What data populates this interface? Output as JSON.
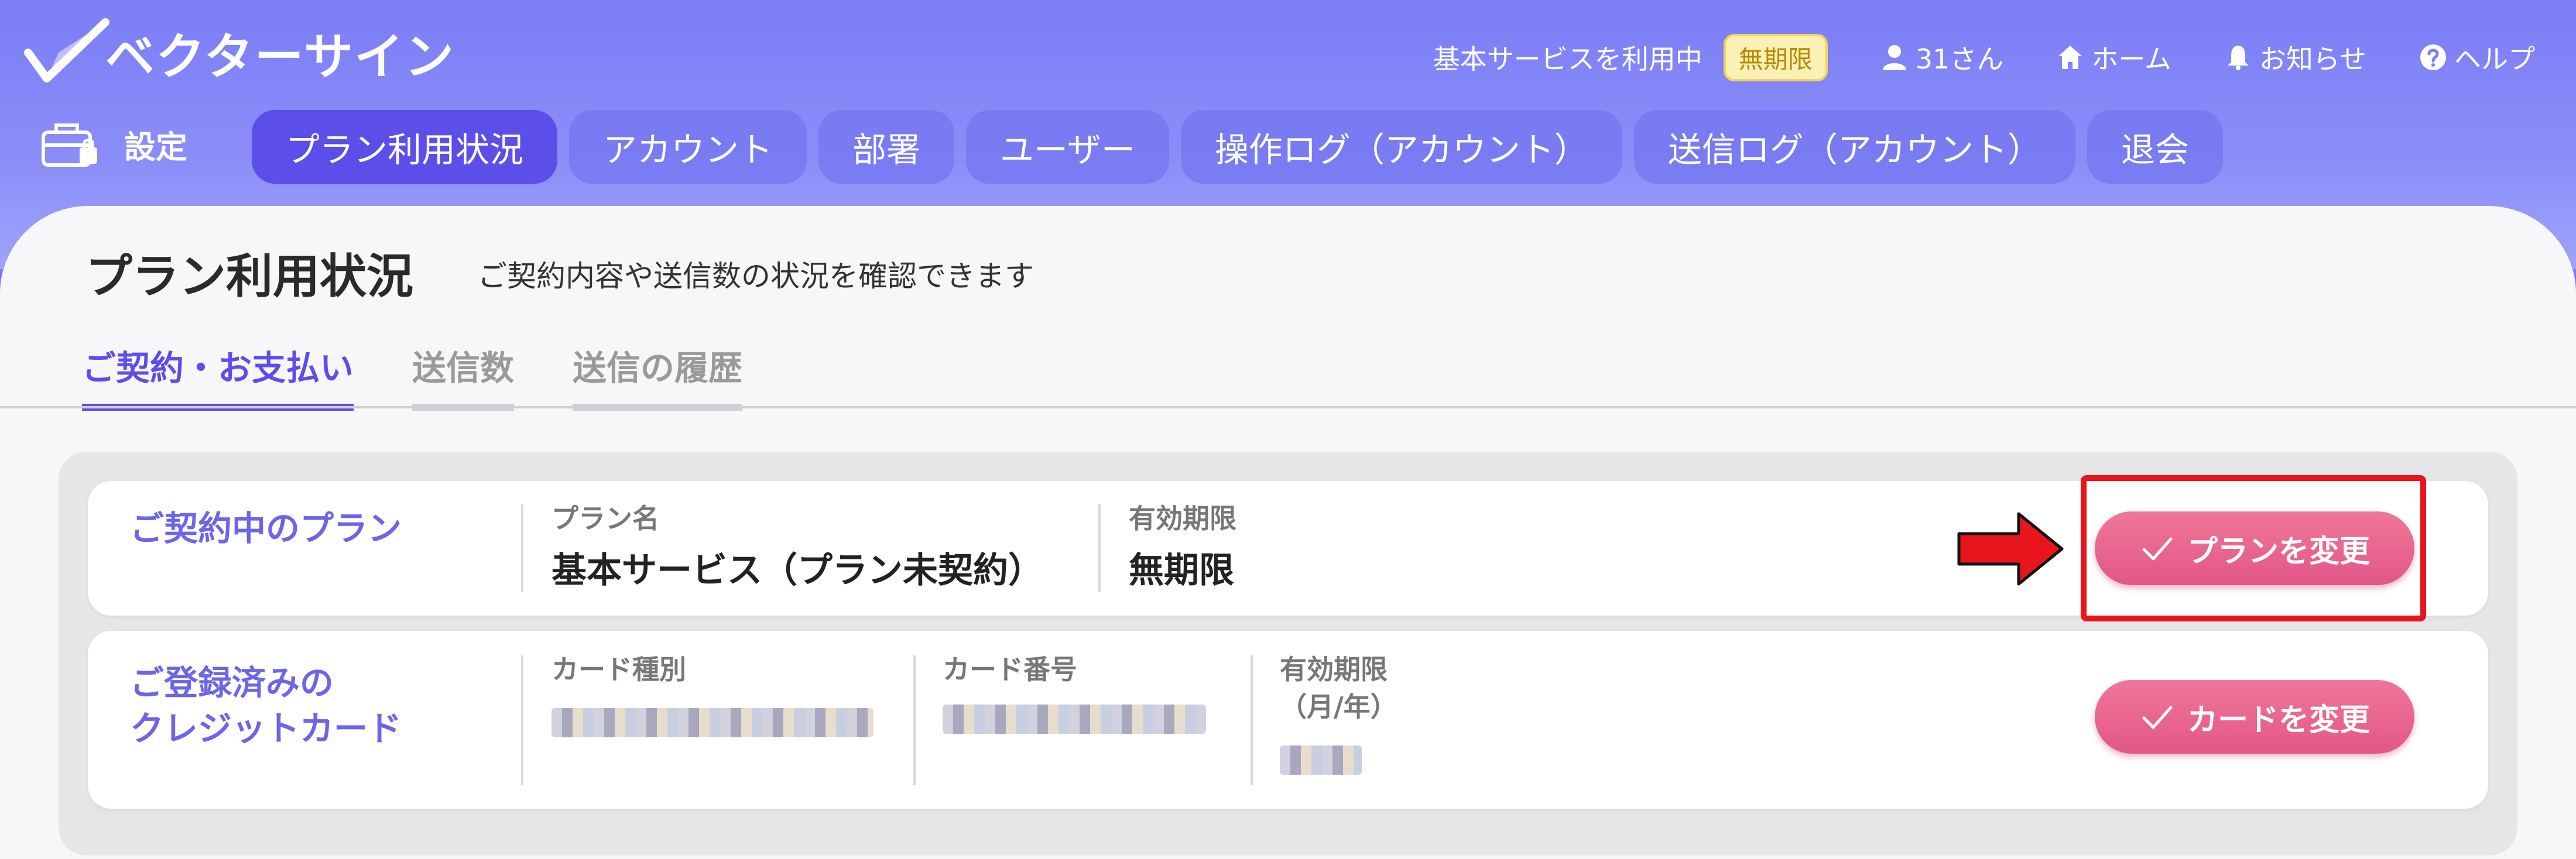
{
  "app": {
    "logo_text": "ベクターサイン"
  },
  "topnav": {
    "service_text": "基本サービスを利用中",
    "service_badge": "無期限",
    "user": "31さん",
    "home": "ホーム",
    "notice": "お知らせ",
    "help": "ヘルプ"
  },
  "settings_label": "設定",
  "tabs": [
    {
      "label": "プラン利用状況",
      "active": true
    },
    {
      "label": "アカウント"
    },
    {
      "label": "部署"
    },
    {
      "label": "ユーザー"
    },
    {
      "label": "操作ログ（アカウント）"
    },
    {
      "label": "送信ログ（アカウント）"
    },
    {
      "label": "退会"
    }
  ],
  "page": {
    "title": "プラン利用状況",
    "subtitle": "ご契約内容や送信数の状況を確認できます"
  },
  "subtabs": [
    {
      "label": "ご契約・お支払い",
      "active": true
    },
    {
      "label": "送信数"
    },
    {
      "label": "送信の履歴"
    }
  ],
  "plan_row": {
    "title": "ご契約中のプラン",
    "plan_name_label": "プラン名",
    "plan_name_value": "基本サービス（プラン未契約）",
    "expiry_label": "有効期限",
    "expiry_value": "無期限",
    "button": "プランを変更"
  },
  "card_row": {
    "title_line1": "ご登録済みの",
    "title_line2": "クレジットカード",
    "card_type_label": "カード種別",
    "card_number_label": "カード番号",
    "expiry_label_line1": "有効期限",
    "expiry_label_line2": "（月/年）",
    "button": "カードを変更"
  },
  "colors": {
    "header": "#7b7ef6",
    "active_tab": "#5c4ee8",
    "button": "#e25786",
    "highlight": "#e8161c"
  }
}
